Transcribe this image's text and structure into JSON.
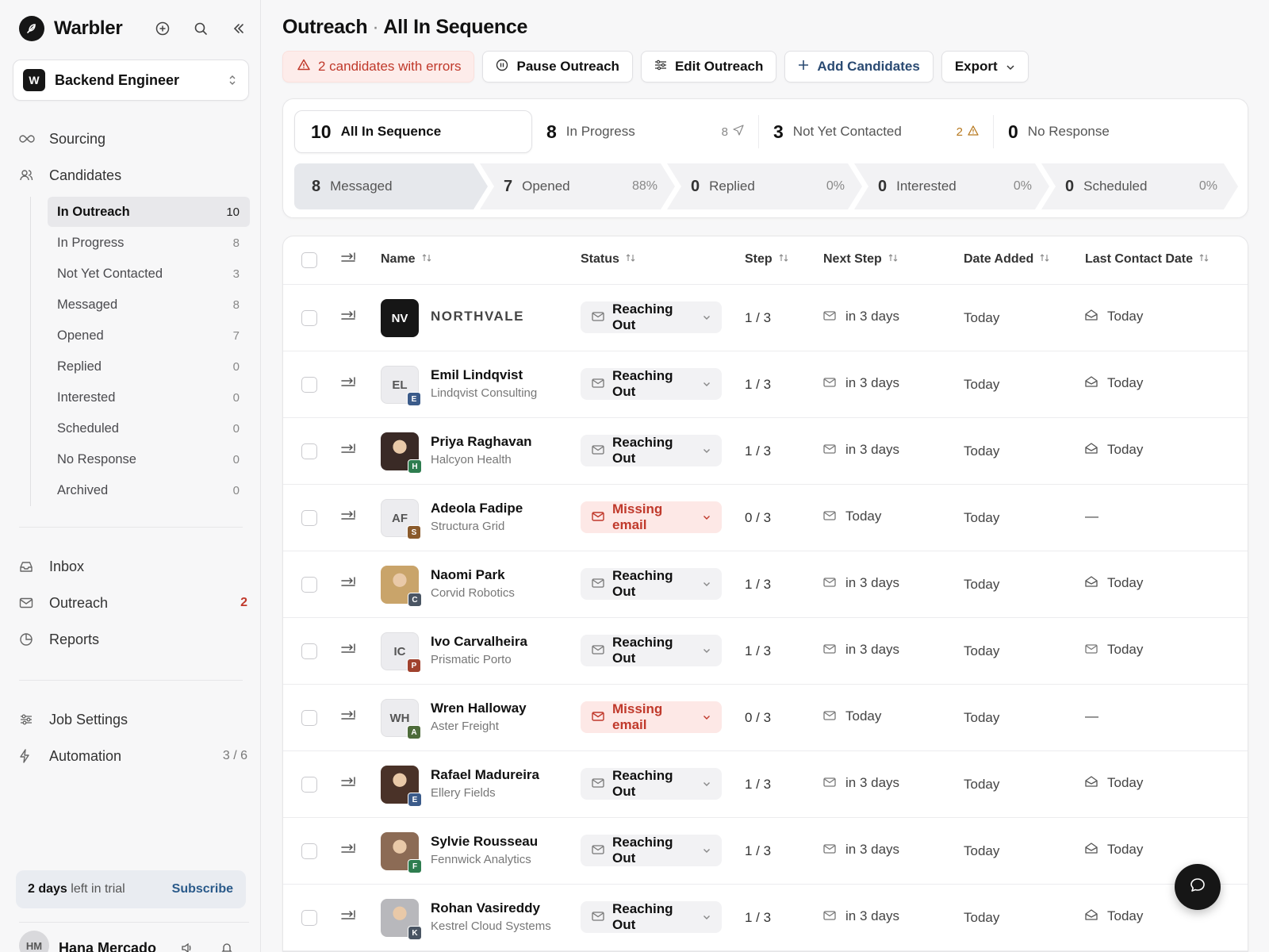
{
  "brand": {
    "name": "Warbler"
  },
  "job": {
    "badge": "W",
    "name": "Backend Engineer"
  },
  "nav": {
    "sourcing": "Sourcing",
    "candidates": "Candidates",
    "inbox": "Inbox",
    "outreach": "Outreach",
    "outreach_count": "2",
    "reports": "Reports",
    "job_settings": "Job Settings",
    "automation": "Automation",
    "automation_count": "3 / 6"
  },
  "subnav": [
    {
      "label": "In Outreach",
      "count": "10",
      "active": true
    },
    {
      "label": "In Progress",
      "count": "8"
    },
    {
      "label": "Not Yet Contacted",
      "count": "3"
    },
    {
      "label": "Messaged",
      "count": "8"
    },
    {
      "label": "Opened",
      "count": "7"
    },
    {
      "label": "Replied",
      "count": "0"
    },
    {
      "label": "Interested",
      "count": "0"
    },
    {
      "label": "Scheduled",
      "count": "0"
    },
    {
      "label": "No Response",
      "count": "0"
    },
    {
      "label": "Archived",
      "count": "0"
    }
  ],
  "trial": {
    "days": "2 days",
    "suffix": " left in trial",
    "subscribe": "Subscribe"
  },
  "user": {
    "initials": "HM",
    "name": "Hana Mercado"
  },
  "page": {
    "title_a": "Outreach",
    "title_sep": "·",
    "title_b": "All In Sequence"
  },
  "toolbar": {
    "errors": "2 candidates with errors",
    "pause": "Pause Outreach",
    "edit": "Edit Outreach",
    "add": "Add Candidates",
    "export": "Export"
  },
  "stats": {
    "tabs": [
      {
        "count": "10",
        "label": "All In Sequence",
        "meta": ""
      },
      {
        "count": "8",
        "label": "In Progress",
        "meta": "8"
      },
      {
        "count": "3",
        "label": "Not Yet Contacted",
        "meta": "2"
      },
      {
        "count": "0",
        "label": "No Response",
        "meta": ""
      }
    ],
    "funnel": [
      {
        "count": "8",
        "label": "Messaged",
        "pct": ""
      },
      {
        "count": "7",
        "label": "Opened",
        "pct": "88%"
      },
      {
        "count": "0",
        "label": "Replied",
        "pct": "0%"
      },
      {
        "count": "0",
        "label": "Interested",
        "pct": "0%"
      },
      {
        "count": "0",
        "label": "Scheduled",
        "pct": "0%"
      }
    ]
  },
  "table": {
    "columns": [
      "Name",
      "Status",
      "Step",
      "Next Step",
      "Date Added",
      "Last Contact Date"
    ],
    "rows": [
      {
        "initials": "NV",
        "name": "NORTHVALE",
        "company": "",
        "status": "Reaching Out",
        "step": "1 / 3",
        "next": "in 3 days",
        "added": "Today",
        "last": "Today",
        "kind": "company"
      },
      {
        "initials": "EL",
        "name": "Emil Lindqvist",
        "company": "Lindqvist Consulting",
        "badge": "E",
        "badge_color": "#3b5b8a",
        "status": "Reaching Out",
        "step": "1 / 3",
        "next": "in 3 days",
        "added": "Today",
        "last": "Today"
      },
      {
        "initials": "",
        "name": "Priya Raghavan",
        "company": "Halcyon Health",
        "badge": "H",
        "badge_color": "#2e7d4f",
        "photo": "#3a2a26",
        "status": "Reaching Out",
        "step": "1 / 3",
        "next": "in 3 days",
        "added": "Today",
        "last": "Today"
      },
      {
        "initials": "AF",
        "name": "Adeola Fadipe",
        "company": "Structura Grid",
        "badge": "S",
        "badge_color": "#8a5a2b",
        "status": "Missing email",
        "step": "0 / 3",
        "next": "Today",
        "added": "Today",
        "last": "—",
        "missing": true
      },
      {
        "initials": "",
        "name": "Naomi Park",
        "company": "Corvid Robotics",
        "badge": "C",
        "badge_color": "#4a5563",
        "photo": "#c9a46a",
        "status": "Reaching Out",
        "step": "1 / 3",
        "next": "in 3 days",
        "added": "Today",
        "last": "Today"
      },
      {
        "initials": "IC",
        "name": "Ivo Carvalheira",
        "company": "Prismatic Porto",
        "badge": "P",
        "badge_color": "#a0422e",
        "status": "Reaching Out",
        "step": "1 / 3",
        "next": "in 3 days",
        "added": "Today",
        "last": "Today",
        "last_icon": "mail"
      },
      {
        "initials": "WH",
        "name": "Wren Halloway",
        "company": "Aster Freight",
        "badge": "A",
        "badge_color": "#4d6b3a",
        "status": "Missing email",
        "step": "0 / 3",
        "next": "Today",
        "added": "Today",
        "last": "—",
        "missing": true
      },
      {
        "initials": "",
        "name": "Rafael Madureira",
        "company": "Ellery Fields",
        "badge": "E",
        "badge_color": "#3b5b8a",
        "photo": "#4a3228",
        "status": "Reaching Out",
        "step": "1 / 3",
        "next": "in 3 days",
        "added": "Today",
        "last": "Today"
      },
      {
        "initials": "",
        "name": "Sylvie Rousseau",
        "company": "Fennwick Analytics",
        "badge": "F",
        "badge_color": "#2e7d4f",
        "photo": "#8c6b55",
        "status": "Reaching Out",
        "step": "1 / 3",
        "next": "in 3 days",
        "added": "Today",
        "last": "Today"
      },
      {
        "initials": "",
        "name": "Rohan Vasireddy",
        "company": "Kestrel Cloud Systems",
        "badge": "K",
        "badge_color": "#4a5563",
        "photo": "#b8b8bc",
        "status": "Reaching Out",
        "step": "1 / 3",
        "next": "in 3 days",
        "added": "Today",
        "last": "Today"
      }
    ]
  }
}
